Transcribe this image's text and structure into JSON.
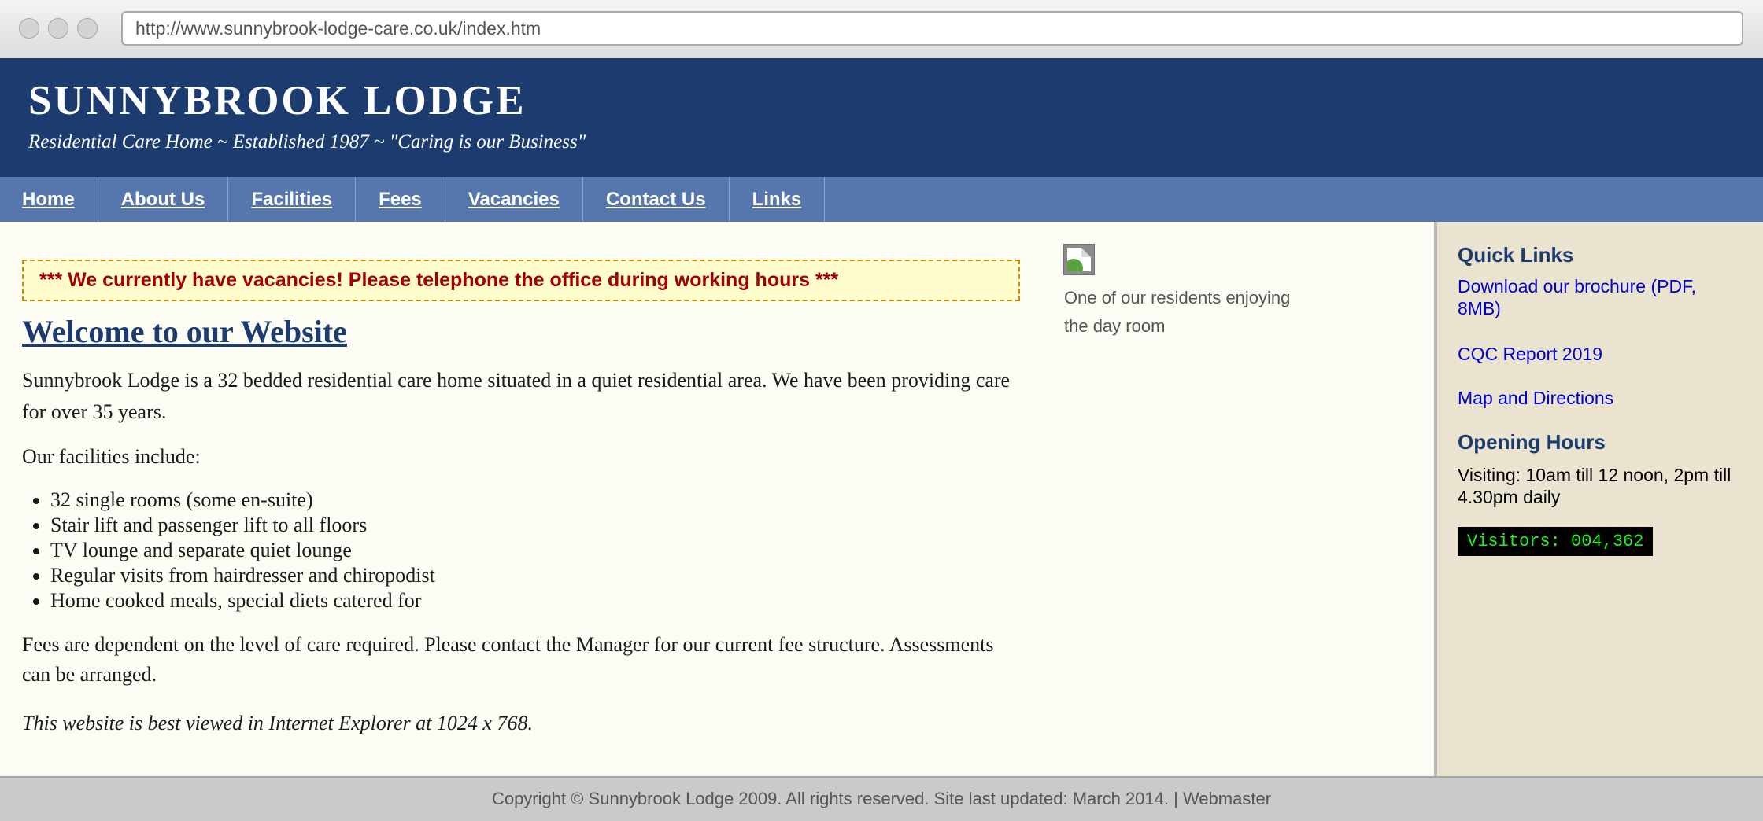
{
  "browser": {
    "url": "http://www.sunnybrook-lodge-care.co.uk/index.htm"
  },
  "header": {
    "title": "SUNNYBROOK LODGE",
    "tagline": "Residential Care Home ~ Established 1987 ~ \"Caring is our Business\""
  },
  "nav": {
    "items": [
      {
        "label": "Home"
      },
      {
        "label": "About Us"
      },
      {
        "label": "Facilities"
      },
      {
        "label": "Fees"
      },
      {
        "label": "Vacancies"
      },
      {
        "label": "Contact Us"
      },
      {
        "label": "Links"
      }
    ]
  },
  "main": {
    "notice": "*** We currently have vacancies! Please telephone the office during working hours ***",
    "heading": "Welcome to our Website",
    "intro": "Sunnybrook Lodge is a 32 bedded residential care home situated in a quiet residential area. We have been providing care for over 35 years.",
    "facilities_intro": "Our facilities include:",
    "facilities": [
      "32 single rooms (some en-suite)",
      "Stair lift and passenger lift to all floors",
      "TV lounge and separate quiet lounge",
      "Regular visits from hairdresser and chiropodist",
      "Home cooked meals, special diets catered for"
    ],
    "fees": "Fees are dependent on the level of care required. Please contact the Manager for our current fee structure. Assessments can be arranged.",
    "browser_note": "This website is best viewed in Internet Explorer at 1024 x 768.",
    "photo_caption": "One of our residents enjoying the day room",
    "photo_icon": "broken-image-icon"
  },
  "sidebar": {
    "quick_links_heading": "Quick Links",
    "links": [
      {
        "label": "Download our brochure (PDF, 8MB)"
      },
      {
        "label": "CQC Report 2019"
      },
      {
        "label": "Map and Directions"
      }
    ],
    "hours_heading": "Opening Hours",
    "hours_text": "Visiting: 10am till 12 noon, 2pm till 4.30pm daily",
    "counter": "Visitors: 004,362"
  },
  "footer": {
    "text": "Copyright © Sunnybrook Lodge 2009. All rights reserved. Site last updated: March 2014. | Webmaster"
  },
  "colors": {
    "header_bg": "#1c3b6e",
    "nav_bg": "#5577ad",
    "notice_text": "#a30000",
    "link": "#0000cc",
    "counter_text": "#22ee22"
  }
}
